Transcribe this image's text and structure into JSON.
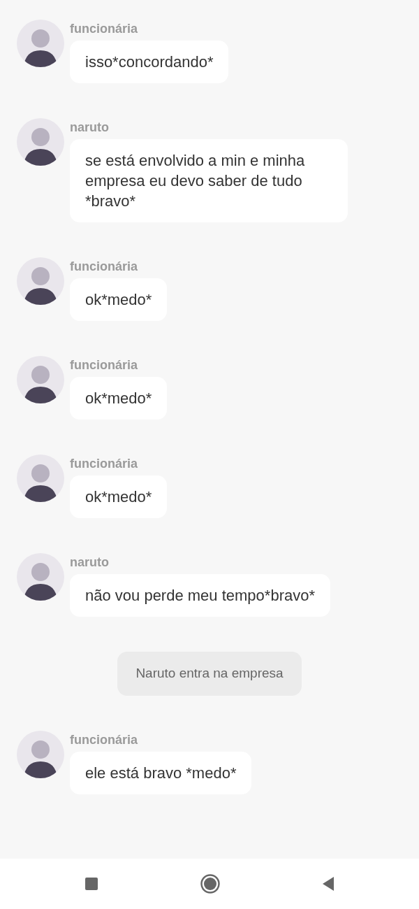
{
  "messages": [
    {
      "kind": "message",
      "sender": "funcionária",
      "text": "isso*concordando*"
    },
    {
      "kind": "message",
      "sender": "naruto",
      "text": "se está envolvido a min e minha empresa eu devo saber de tudo *bravo*"
    },
    {
      "kind": "message",
      "sender": "funcionária",
      "text": "ok*medo*"
    },
    {
      "kind": "message",
      "sender": "funcionária",
      "text": "ok*medo*"
    },
    {
      "kind": "message",
      "sender": "funcionária",
      "text": "ok*medo*"
    },
    {
      "kind": "message",
      "sender": "naruto",
      "text": "não vou perde meu tempo*bravo*"
    },
    {
      "kind": "system",
      "text": "Naruto entra na empresa"
    },
    {
      "kind": "message",
      "sender": "funcionária",
      "text": "ele está bravo *medo*"
    }
  ]
}
